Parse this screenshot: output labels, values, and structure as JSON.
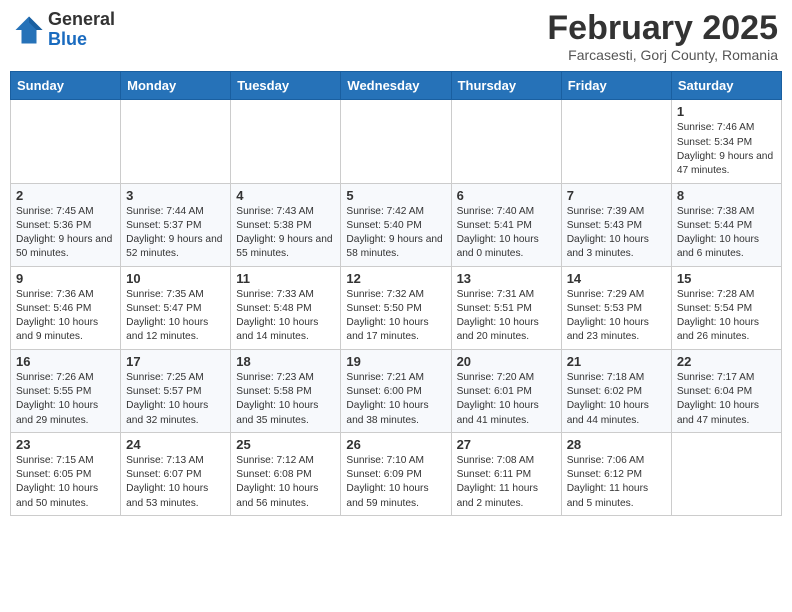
{
  "header": {
    "logo_general": "General",
    "logo_blue": "Blue",
    "month_title": "February 2025",
    "location": "Farcasesti, Gorj County, Romania"
  },
  "weekdays": [
    "Sunday",
    "Monday",
    "Tuesday",
    "Wednesday",
    "Thursday",
    "Friday",
    "Saturday"
  ],
  "weeks": [
    [
      {
        "day": "",
        "info": ""
      },
      {
        "day": "",
        "info": ""
      },
      {
        "day": "",
        "info": ""
      },
      {
        "day": "",
        "info": ""
      },
      {
        "day": "",
        "info": ""
      },
      {
        "day": "",
        "info": ""
      },
      {
        "day": "1",
        "info": "Sunrise: 7:46 AM\nSunset: 5:34 PM\nDaylight: 9 hours and 47 minutes."
      }
    ],
    [
      {
        "day": "2",
        "info": "Sunrise: 7:45 AM\nSunset: 5:36 PM\nDaylight: 9 hours and 50 minutes."
      },
      {
        "day": "3",
        "info": "Sunrise: 7:44 AM\nSunset: 5:37 PM\nDaylight: 9 hours and 52 minutes."
      },
      {
        "day": "4",
        "info": "Sunrise: 7:43 AM\nSunset: 5:38 PM\nDaylight: 9 hours and 55 minutes."
      },
      {
        "day": "5",
        "info": "Sunrise: 7:42 AM\nSunset: 5:40 PM\nDaylight: 9 hours and 58 minutes."
      },
      {
        "day": "6",
        "info": "Sunrise: 7:40 AM\nSunset: 5:41 PM\nDaylight: 10 hours and 0 minutes."
      },
      {
        "day": "7",
        "info": "Sunrise: 7:39 AM\nSunset: 5:43 PM\nDaylight: 10 hours and 3 minutes."
      },
      {
        "day": "8",
        "info": "Sunrise: 7:38 AM\nSunset: 5:44 PM\nDaylight: 10 hours and 6 minutes."
      }
    ],
    [
      {
        "day": "9",
        "info": "Sunrise: 7:36 AM\nSunset: 5:46 PM\nDaylight: 10 hours and 9 minutes."
      },
      {
        "day": "10",
        "info": "Sunrise: 7:35 AM\nSunset: 5:47 PM\nDaylight: 10 hours and 12 minutes."
      },
      {
        "day": "11",
        "info": "Sunrise: 7:33 AM\nSunset: 5:48 PM\nDaylight: 10 hours and 14 minutes."
      },
      {
        "day": "12",
        "info": "Sunrise: 7:32 AM\nSunset: 5:50 PM\nDaylight: 10 hours and 17 minutes."
      },
      {
        "day": "13",
        "info": "Sunrise: 7:31 AM\nSunset: 5:51 PM\nDaylight: 10 hours and 20 minutes."
      },
      {
        "day": "14",
        "info": "Sunrise: 7:29 AM\nSunset: 5:53 PM\nDaylight: 10 hours and 23 minutes."
      },
      {
        "day": "15",
        "info": "Sunrise: 7:28 AM\nSunset: 5:54 PM\nDaylight: 10 hours and 26 minutes."
      }
    ],
    [
      {
        "day": "16",
        "info": "Sunrise: 7:26 AM\nSunset: 5:55 PM\nDaylight: 10 hours and 29 minutes."
      },
      {
        "day": "17",
        "info": "Sunrise: 7:25 AM\nSunset: 5:57 PM\nDaylight: 10 hours and 32 minutes."
      },
      {
        "day": "18",
        "info": "Sunrise: 7:23 AM\nSunset: 5:58 PM\nDaylight: 10 hours and 35 minutes."
      },
      {
        "day": "19",
        "info": "Sunrise: 7:21 AM\nSunset: 6:00 PM\nDaylight: 10 hours and 38 minutes."
      },
      {
        "day": "20",
        "info": "Sunrise: 7:20 AM\nSunset: 6:01 PM\nDaylight: 10 hours and 41 minutes."
      },
      {
        "day": "21",
        "info": "Sunrise: 7:18 AM\nSunset: 6:02 PM\nDaylight: 10 hours and 44 minutes."
      },
      {
        "day": "22",
        "info": "Sunrise: 7:17 AM\nSunset: 6:04 PM\nDaylight: 10 hours and 47 minutes."
      }
    ],
    [
      {
        "day": "23",
        "info": "Sunrise: 7:15 AM\nSunset: 6:05 PM\nDaylight: 10 hours and 50 minutes."
      },
      {
        "day": "24",
        "info": "Sunrise: 7:13 AM\nSunset: 6:07 PM\nDaylight: 10 hours and 53 minutes."
      },
      {
        "day": "25",
        "info": "Sunrise: 7:12 AM\nSunset: 6:08 PM\nDaylight: 10 hours and 56 minutes."
      },
      {
        "day": "26",
        "info": "Sunrise: 7:10 AM\nSunset: 6:09 PM\nDaylight: 10 hours and 59 minutes."
      },
      {
        "day": "27",
        "info": "Sunrise: 7:08 AM\nSunset: 6:11 PM\nDaylight: 11 hours and 2 minutes."
      },
      {
        "day": "28",
        "info": "Sunrise: 7:06 AM\nSunset: 6:12 PM\nDaylight: 11 hours and 5 minutes."
      },
      {
        "day": "",
        "info": ""
      }
    ]
  ]
}
